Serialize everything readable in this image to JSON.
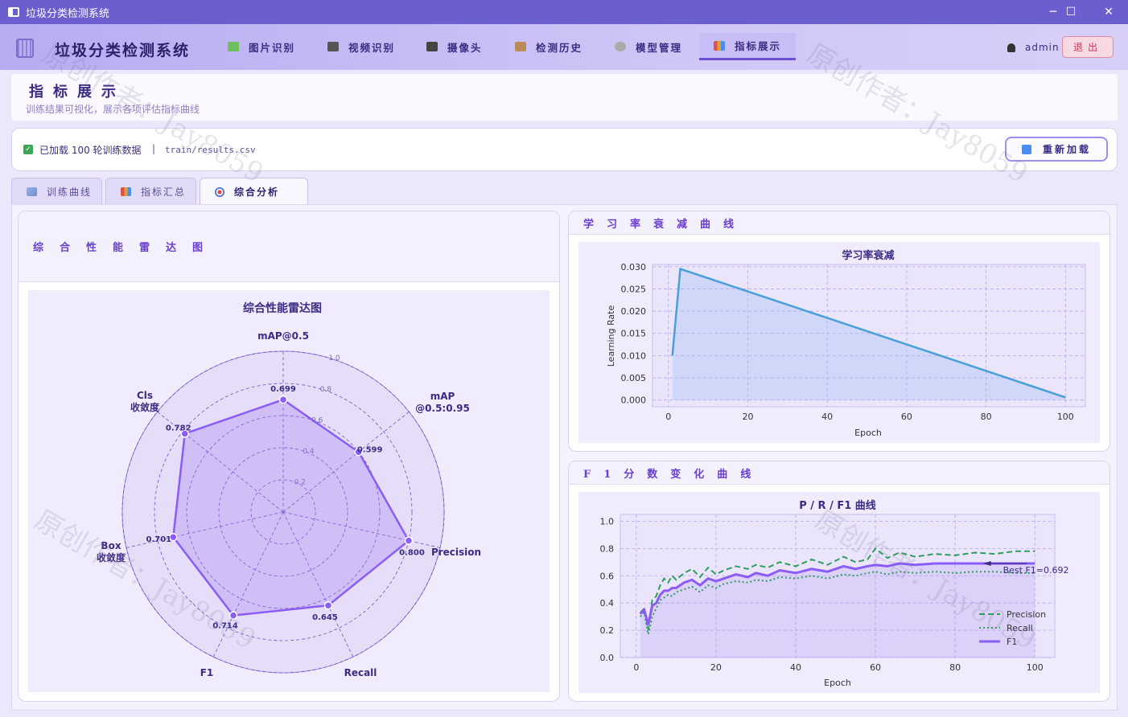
{
  "window": {
    "title": "垃圾分类检测系统",
    "minimize": "─",
    "maximize": "☐",
    "close": "✕"
  },
  "nav": {
    "brand": "垃圾分类检测系统",
    "items": [
      {
        "label": "图片识别",
        "icon": "image-icon",
        "color": "#6cbf5a"
      },
      {
        "label": "视频识别",
        "icon": "film-icon",
        "color": "#555"
      },
      {
        "label": "摄像头",
        "icon": "camera-icon",
        "color": "#444"
      },
      {
        "label": "检测历史",
        "icon": "clipboard-icon",
        "color": "#b98c5a"
      },
      {
        "label": "模型管理",
        "icon": "gear-icon",
        "color": "#999"
      },
      {
        "label": "指标展示",
        "icon": "bar-chart-icon",
        "color": "#e0a030"
      }
    ],
    "user": "admin",
    "logout": "退出"
  },
  "page": {
    "title": "指标展示",
    "subtitle": "训练结果可视化，展示各项评估指标曲线"
  },
  "status": {
    "text": "已加载 100 轮训练数据",
    "separator": "|",
    "file": "train/results.csv",
    "reload": "重新加载"
  },
  "tabs": [
    {
      "label": "训练曲线",
      "icon": "line-chart-icon"
    },
    {
      "label": "指标汇总",
      "icon": "bar-chart-icon"
    },
    {
      "label": "综合分析",
      "icon": "target-icon"
    }
  ],
  "watermark": {
    "line1": "原创作者：Jay8059"
  },
  "panels": {
    "radar_title": "综合性能雷达图",
    "lr_title": "学习率衰减曲线",
    "f1_title": "F1分数变化曲线"
  },
  "chart_data": [
    {
      "type": "radar",
      "title": "综合性能雷达图",
      "axes": [
        "mAP@0.5",
        "mAP\n@0.5:0.95",
        "Precision",
        "Recall",
        "F1",
        "Box\n收敛度",
        "Cls\n收敛度"
      ],
      "values": [
        0.699,
        0.599,
        0.8,
        0.645,
        0.714,
        0.701,
        0.782
      ],
      "value_labels": [
        "0.699",
        "0.599",
        "0.800",
        "0.645",
        "0.714",
        "0.701",
        "0.782"
      ],
      "rings": [
        0.2,
        0.4,
        0.6,
        0.8,
        1.0
      ],
      "ring_labels": [
        "0.2",
        "0.4",
        "0.6",
        "0.8",
        "1.0"
      ],
      "color": "#8b5cf6"
    },
    {
      "type": "line",
      "title": "学习率衰减",
      "xlabel": "Epoch",
      "ylabel": "Learning Rate",
      "xlim": [
        -4,
        105
      ],
      "ylim": [
        -0.0015,
        0.0305
      ],
      "xticks": [
        0,
        20,
        40,
        60,
        80,
        100
      ],
      "yticks": [
        0.0,
        0.005,
        0.01,
        0.015,
        0.02,
        0.025,
        0.03
      ],
      "ytick_labels": [
        "0.000",
        "0.005",
        "0.010",
        "0.015",
        "0.020",
        "0.025",
        "0.030"
      ],
      "series": [
        {
          "x": [
            1,
            3,
            100
          ],
          "y": [
            0.01,
            0.0295,
            0.0006
          ]
        }
      ],
      "grid": true,
      "color": "#4a9fd8"
    },
    {
      "type": "line",
      "title": "P / R / F1 曲线",
      "xlabel": "Epoch",
      "xlim": [
        -4,
        105
      ],
      "ylim": [
        0,
        1.05
      ],
      "xticks": [
        0,
        20,
        40,
        60,
        80,
        100
      ],
      "yticks": [
        0.0,
        0.2,
        0.4,
        0.6,
        0.8,
        1.0
      ],
      "ytick_labels": [
        "0.0",
        "0.2",
        "0.4",
        "0.6",
        "0.8",
        "1.0"
      ],
      "grid": true,
      "legend": "bottom-right",
      "annotation": "Best F1=0.692",
      "series": [
        {
          "name": "Precision",
          "style": "dashed",
          "color": "#2e9e5e",
          "x": [
            1,
            2,
            3,
            4,
            5,
            6,
            7,
            8,
            9,
            10,
            12,
            14,
            16,
            18,
            20,
            22,
            25,
            28,
            30,
            33,
            36,
            40,
            44,
            48,
            52,
            55,
            58,
            60,
            63,
            66,
            70,
            75,
            80,
            85,
            90,
            95,
            100
          ],
          "y": [
            0.33,
            0.36,
            0.2,
            0.42,
            0.45,
            0.53,
            0.58,
            0.55,
            0.6,
            0.57,
            0.62,
            0.65,
            0.59,
            0.66,
            0.61,
            0.64,
            0.67,
            0.65,
            0.68,
            0.66,
            0.7,
            0.67,
            0.72,
            0.68,
            0.74,
            0.7,
            0.72,
            0.8,
            0.73,
            0.77,
            0.74,
            0.76,
            0.75,
            0.77,
            0.76,
            0.78,
            0.78
          ]
        },
        {
          "name": "Recall",
          "style": "dotted",
          "color": "#2e9e5e",
          "x": [
            1,
            2,
            3,
            4,
            5,
            6,
            7,
            8,
            9,
            10,
            12,
            14,
            16,
            18,
            20,
            22,
            25,
            28,
            30,
            33,
            36,
            40,
            44,
            48,
            52,
            55,
            58,
            60,
            63,
            66,
            70,
            75,
            80,
            85,
            90,
            95,
            100
          ],
          "y": [
            0.3,
            0.33,
            0.17,
            0.3,
            0.36,
            0.42,
            0.44,
            0.46,
            0.45,
            0.48,
            0.5,
            0.52,
            0.48,
            0.53,
            0.51,
            0.54,
            0.56,
            0.55,
            0.57,
            0.56,
            0.59,
            0.58,
            0.6,
            0.58,
            0.61,
            0.6,
            0.62,
            0.63,
            0.61,
            0.63,
            0.62,
            0.63,
            0.62,
            0.63,
            0.63,
            0.62,
            0.62
          ]
        },
        {
          "name": "F1",
          "style": "solid",
          "color": "#8b5cf6",
          "x": [
            1,
            2,
            3,
            4,
            5,
            6,
            7,
            8,
            9,
            10,
            12,
            14,
            16,
            18,
            20,
            22,
            25,
            28,
            30,
            33,
            36,
            40,
            44,
            48,
            52,
            55,
            58,
            60,
            63,
            66,
            70,
            75,
            80,
            85,
            90,
            95,
            100
          ],
          "y": [
            0.32,
            0.35,
            0.24,
            0.38,
            0.4,
            0.46,
            0.49,
            0.49,
            0.51,
            0.51,
            0.55,
            0.57,
            0.53,
            0.58,
            0.56,
            0.58,
            0.61,
            0.59,
            0.62,
            0.6,
            0.64,
            0.62,
            0.65,
            0.63,
            0.67,
            0.65,
            0.67,
            0.68,
            0.67,
            0.69,
            0.68,
            0.69,
            0.69,
            0.69,
            0.69,
            0.69,
            0.69
          ]
        }
      ]
    }
  ]
}
